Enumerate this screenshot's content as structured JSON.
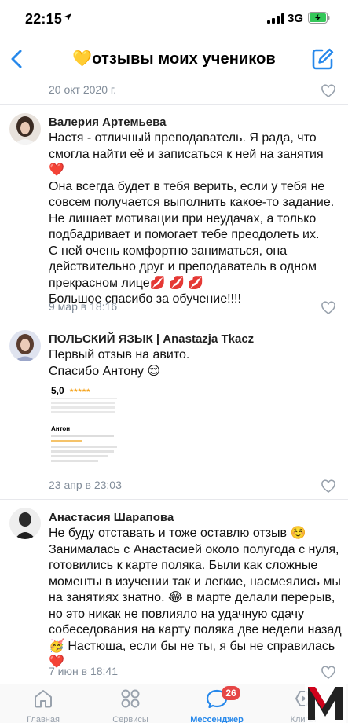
{
  "status": {
    "time": "22:15",
    "network": "3G"
  },
  "chat": {
    "title": "💛отзывы моих учеников"
  },
  "messages": [
    {
      "date": "20 окт 2020 г."
    },
    {
      "author": "Валерия Артемьева",
      "lines": [
        "Настя - отличный преподаватель. Я рада, что",
        "смогла найти её и записаться к ней на занятия",
        "❤️",
        "Она всегда будет в тебя верить, если у тебя не",
        "совсем получается выполнить какое-то задание.",
        "Не лишает мотивации при неудачах, а только",
        "подбадривает и помогает тебе преодолеть их.",
        "С ней очень комфортно заниматься, она",
        "действительно друг и преподаватель в одном",
        "прекрасном лице💋 💋 💋",
        "Большое спасибо за обучение!!!!"
      ],
      "date": "9 мар в 18:16"
    },
    {
      "author": "ПОЛЬСКИЙ ЯЗЫК | Anastazja Tkacz",
      "lines": [
        "Первый отзыв на авито.",
        "Спасибо Антону 😌"
      ],
      "review_rating": "5,0",
      "review_name": "Антон",
      "date": "23 апр в 23:03"
    },
    {
      "author": "Анастасия Шарапова",
      "lines": [
        "Не буду отставать и тоже оставлю отзыв ☺️",
        "Занималась с Анастасией около полугода с нуля,",
        "готовились к карте поляка. Были как сложные",
        "моменты в изучении так и легкие, насмеялись мы",
        "на занятиях знатно. 😂 в марте делали перерыв,",
        "но это никак не повлияло на удачную сдачу",
        "собеседования на карту поляка две недели назад",
        "🥳 Настюша, если бы не ты, я бы не справилась",
        "❤️"
      ],
      "date": "7 июн в 18:41"
    }
  ],
  "tabs": [
    {
      "label": "Главная",
      "icon": "home-icon"
    },
    {
      "label": "Сервисы",
      "icon": "services-icon"
    },
    {
      "label": "Мессенджер",
      "icon": "messenger-icon",
      "badge": "26",
      "active": true
    },
    {
      "label": "Клипы",
      "icon": "clips-icon"
    }
  ],
  "colors": {
    "accent": "#2688eb",
    "badge": "#e64646",
    "muted": "#818c99"
  }
}
